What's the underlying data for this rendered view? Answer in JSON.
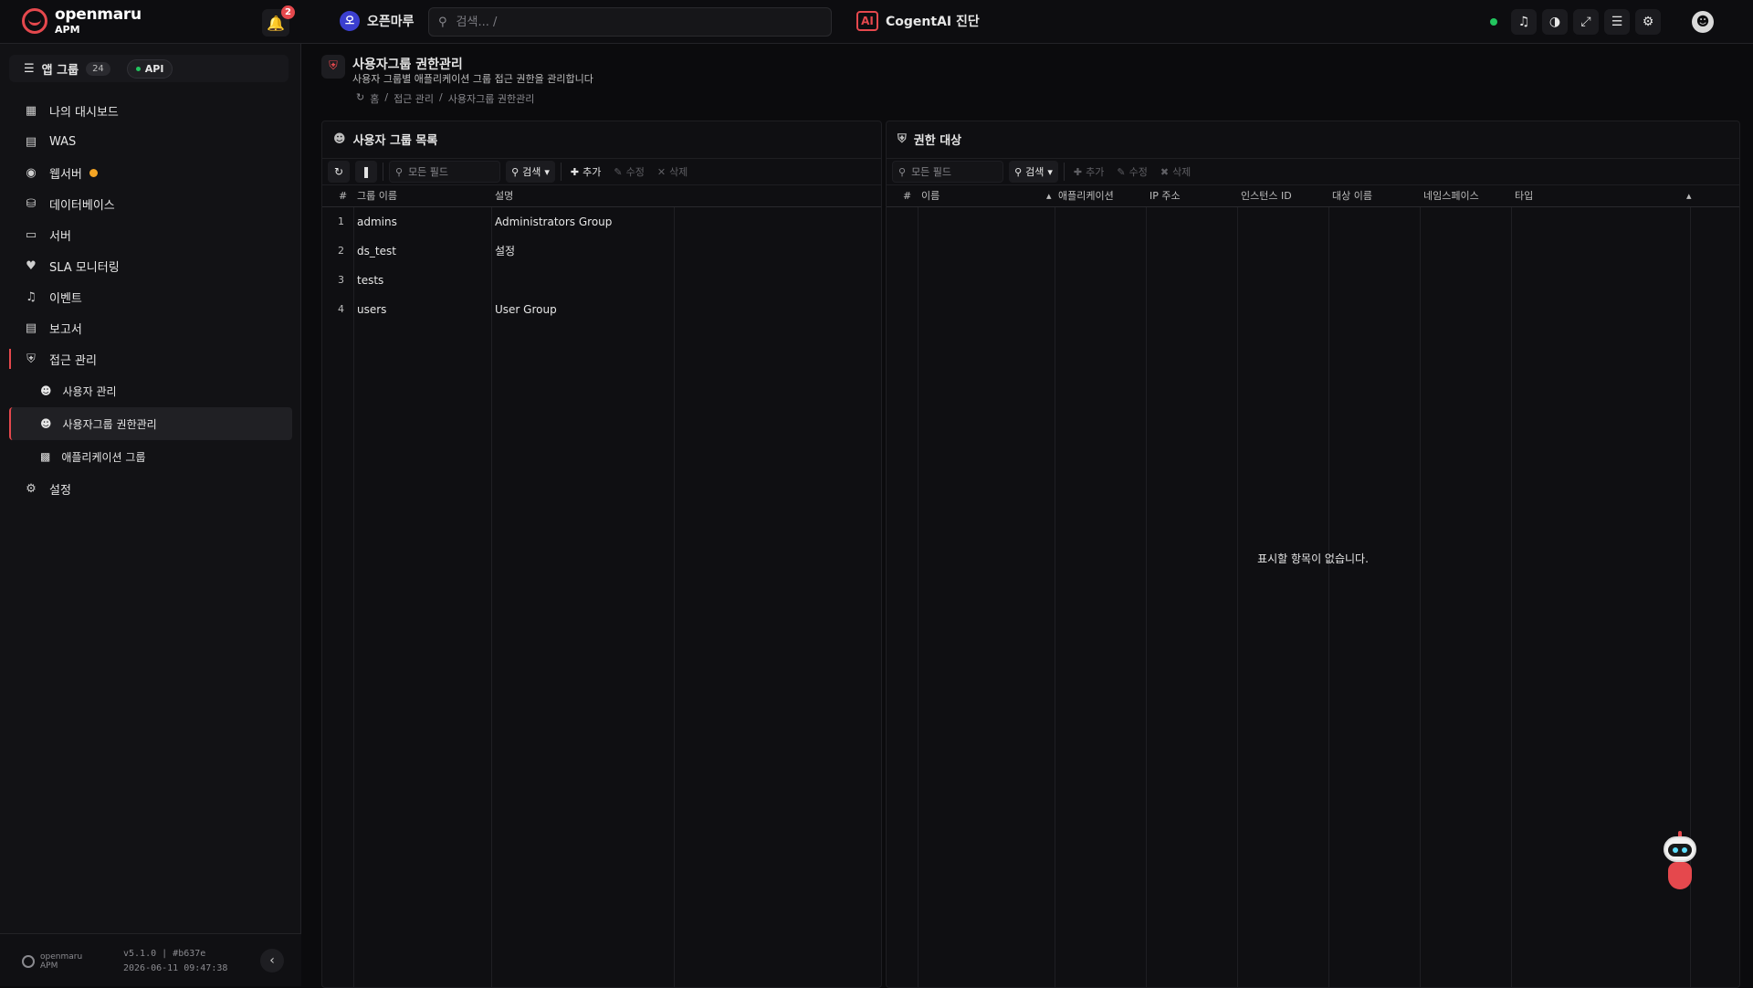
{
  "topbar": {
    "logo_title": "openmaru",
    "logo_sub": "APM",
    "notif_count": "2",
    "tenant_initial": "오",
    "tenant_name": "오픈마루",
    "search_placeholder": "검색... /",
    "ai_label": "AI",
    "ai_name": "CogentAI 진단",
    "status_color": "#22c55e",
    "icons": [
      "bell-icon",
      "contrast-icon",
      "expand-icon",
      "menu-icon",
      "gear-icon",
      "user-icon"
    ]
  },
  "sidebar": {
    "app_group_label": "앱 그룹",
    "app_group_count": "24",
    "api_label": "API",
    "items": [
      {
        "label": "나의 대시보드",
        "icon": "dashboard-icon"
      },
      {
        "label": "WAS",
        "icon": "server-stack-icon"
      },
      {
        "label": "웹서버",
        "icon": "globe-icon"
      },
      {
        "label": "데이터베이스",
        "icon": "database-icon"
      },
      {
        "label": "서버",
        "icon": "monitor-icon"
      },
      {
        "label": "SLA 모니터링",
        "icon": "heartbeat-icon"
      },
      {
        "label": "이벤트",
        "icon": "bell-icon"
      },
      {
        "label": "보고서",
        "icon": "chart-icon"
      },
      {
        "label": "접근 관리",
        "icon": "shield-icon"
      },
      {
        "label": "설정",
        "icon": "gears-icon"
      }
    ],
    "subitems": [
      {
        "label": "사용자 관리",
        "icon": "user-icon"
      },
      {
        "label": "사용자그룹 권한관리",
        "icon": "users-icon"
      },
      {
        "label": "애플리케이션 그룹",
        "icon": "app-group-icon"
      }
    ],
    "footer_logo": "openmaru",
    "footer_logo_sub": "APM",
    "version": "v5.1.0 | #b637e",
    "build_date": "2026-06-11 09:47:38"
  },
  "page": {
    "title": "사용자그룹 권한관리",
    "subtitle": "사용자 그룹별 애플리케이션 그룹 접근 권한을 관리합니다",
    "breadcrumbs": [
      "홈",
      "/",
      "접근 관리",
      "/",
      "사용자그룹 권한관리"
    ]
  },
  "left_panel": {
    "title": "사용자 그룹 목록",
    "search_placeholder": "모든 필드",
    "search_btn": "검색",
    "add": "추가",
    "edit": "수정",
    "delete": "삭제",
    "columns": [
      "#",
      "그룹 이름",
      "설명"
    ],
    "rows": [
      {
        "idx": "1",
        "name": "admins",
        "desc": "Administrators Group"
      },
      {
        "idx": "2",
        "name": "ds_test",
        "desc": "설정"
      },
      {
        "idx": "3",
        "name": "tests",
        "desc": ""
      },
      {
        "idx": "4",
        "name": "users",
        "desc": "User Group"
      }
    ]
  },
  "right_panel": {
    "title": "권한 대상",
    "search_placeholder": "모든 필드",
    "search_btn": "검색",
    "add": "추가",
    "edit": "수정",
    "delete": "삭제",
    "columns": [
      "#",
      "이름",
      "애플리케이션",
      "IP 주소",
      "인스턴스 ID",
      "대상 이름",
      "네임스페이스",
      "타입"
    ],
    "empty_text": "표시할 항목이 없습니다."
  }
}
